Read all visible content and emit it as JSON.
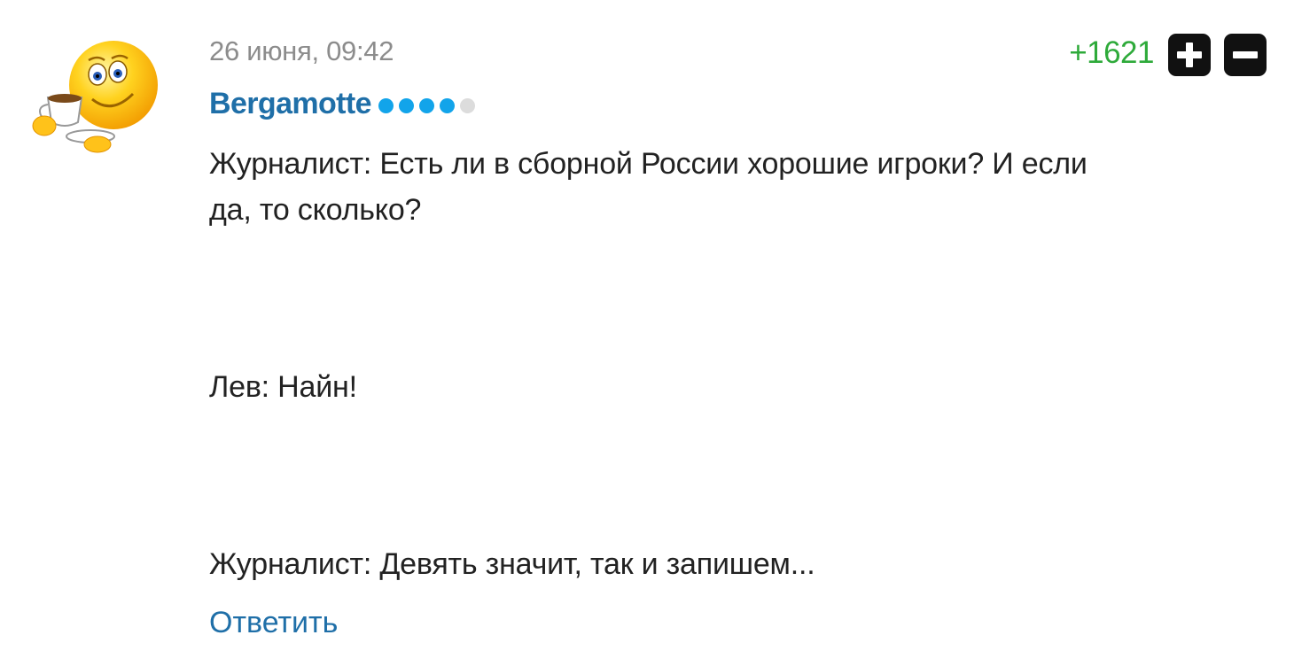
{
  "comment": {
    "date": "26 июня, 09:42",
    "author": "Bergamotte",
    "author_level": {
      "filled": 4,
      "total": 5
    },
    "rating": "+1621",
    "lines": [
      "Журналист: Есть ли в сборной России хорошие игроки? И если",
      "да, то сколько?",
      "Лев: Найн!",
      "Журналист: Девять значит, так и запишем..."
    ],
    "reply_label": "Ответить"
  },
  "icons": {
    "avatar": "smiley-with-coffee-cup-icon",
    "upvote": "plus-icon",
    "downvote": "minus-icon"
  },
  "colors": {
    "author": "#1f6fa8",
    "rating": "#2eaa3a",
    "date": "#8c8c8c",
    "level_dot_on": "#12a4ea",
    "level_dot_off": "#dcdcdc",
    "vote_button": "#111111"
  }
}
